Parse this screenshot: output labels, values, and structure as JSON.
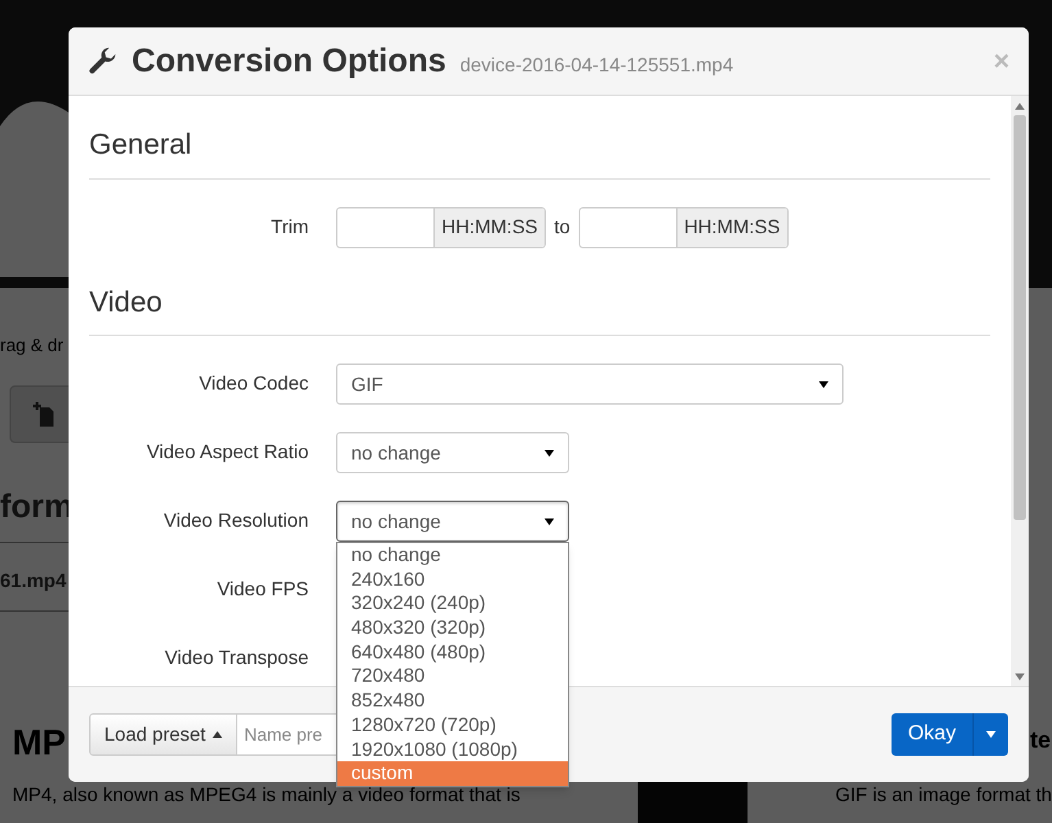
{
  "background_page": {
    "drop_hint": "rag & dr",
    "heading": "form",
    "file_name": "61.mp4",
    "left_card": {
      "title": "MP",
      "text_lines": [
        "MP4, also known as MPEG4 is mainly a video format that is"
      ]
    },
    "right_card": {
      "title": "te",
      "text_lines": [
        "GIF is an image format th"
      ]
    }
  },
  "dialog": {
    "title": "Conversion Options",
    "subtitle": "device-2016-04-14-125551.mp4",
    "close": "×",
    "sections": [
      {
        "heading": "General",
        "rows": [
          {
            "kind": "trim",
            "label": "Trim",
            "addon": "HH:MM:SS",
            "joiner": "to",
            "addon_2": "HH:MM:SS"
          }
        ]
      },
      {
        "heading": "Video",
        "rows": [
          {
            "kind": "select",
            "label": "Video Codec",
            "value": "GIF",
            "wide": true,
            "open": false
          },
          {
            "kind": "select",
            "label": "Video Aspect Ratio",
            "value": "no change",
            "wide": false,
            "open": false
          },
          {
            "kind": "select",
            "label": "Video Resolution",
            "value": "no change",
            "wide": false,
            "open": true,
            "options": [
              {
                "label": "no change",
                "highlighted": false
              },
              {
                "label": "240x160",
                "highlighted": false
              },
              {
                "label": "320x240 (240p)",
                "highlighted": false
              },
              {
                "label": "480x320 (320p)",
                "highlighted": false
              },
              {
                "label": "640x480 (480p)",
                "highlighted": false
              },
              {
                "label": "720x480",
                "highlighted": false
              },
              {
                "label": "852x480",
                "highlighted": false
              },
              {
                "label": "1280x720 (720p)",
                "highlighted": false
              },
              {
                "label": "1920x1080 (1080p)",
                "highlighted": false
              },
              {
                "label": "custom",
                "highlighted": true
              }
            ]
          },
          {
            "kind": "covered",
            "label": "Video FPS"
          },
          {
            "kind": "covered",
            "label": "Video Transpose"
          }
        ]
      }
    ],
    "footer": {
      "load_preset": "Load preset",
      "preset_placeholder": "Name pre",
      "okay": "Okay"
    }
  }
}
